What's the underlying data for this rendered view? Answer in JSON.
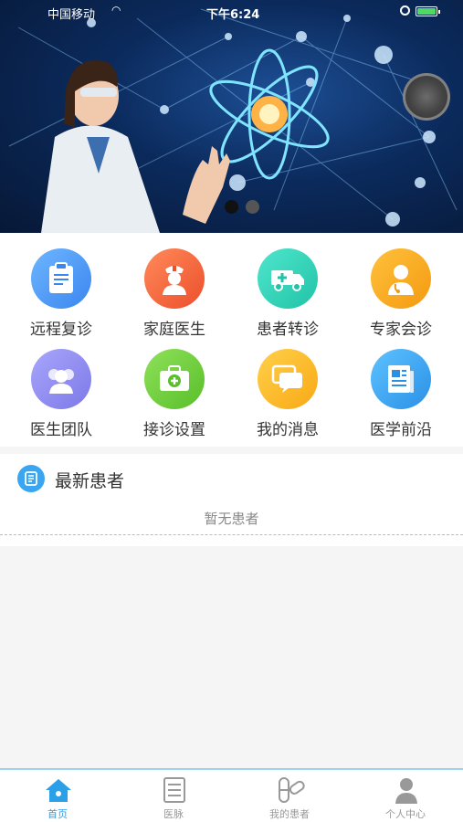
{
  "status_bar": {
    "carrier": "中国移动",
    "time": "下午6:24"
  },
  "banner": {
    "slides": 2,
    "active_slide": 1
  },
  "grid": {
    "items": [
      {
        "label": "远程复诊",
        "icon": "clipboard-icon",
        "color": "#4a9cf5"
      },
      {
        "label": "家庭医生",
        "icon": "nurse-icon",
        "color": "#f2643a"
      },
      {
        "label": "患者转诊",
        "icon": "ambulance-icon",
        "color": "#2fd3b9"
      },
      {
        "label": "专家会诊",
        "icon": "doctor-icon",
        "color": "#f7a61c"
      },
      {
        "label": "医生团队",
        "icon": "team-icon",
        "color": "#8e8cf0"
      },
      {
        "label": "接诊设置",
        "icon": "medical-kit-icon",
        "color": "#6ccf3a"
      },
      {
        "label": "我的消息",
        "icon": "message-icon",
        "color": "#fbb51f"
      },
      {
        "label": "医学前沿",
        "icon": "newspaper-icon",
        "color": "#3aa6f2"
      }
    ]
  },
  "patients": {
    "title": "最新患者",
    "empty_text": "暂无患者",
    "icon": "patient-list-icon"
  },
  "tabbar": {
    "tabs": [
      {
        "label": "首页",
        "icon": "home-icon",
        "active": true
      },
      {
        "label": "医脉",
        "icon": "document-icon",
        "active": false
      },
      {
        "label": "我的患者",
        "icon": "pill-icon",
        "active": false
      },
      {
        "label": "个人中心",
        "icon": "person-icon",
        "active": false
      }
    ],
    "active_color": "#2b9fe8"
  }
}
